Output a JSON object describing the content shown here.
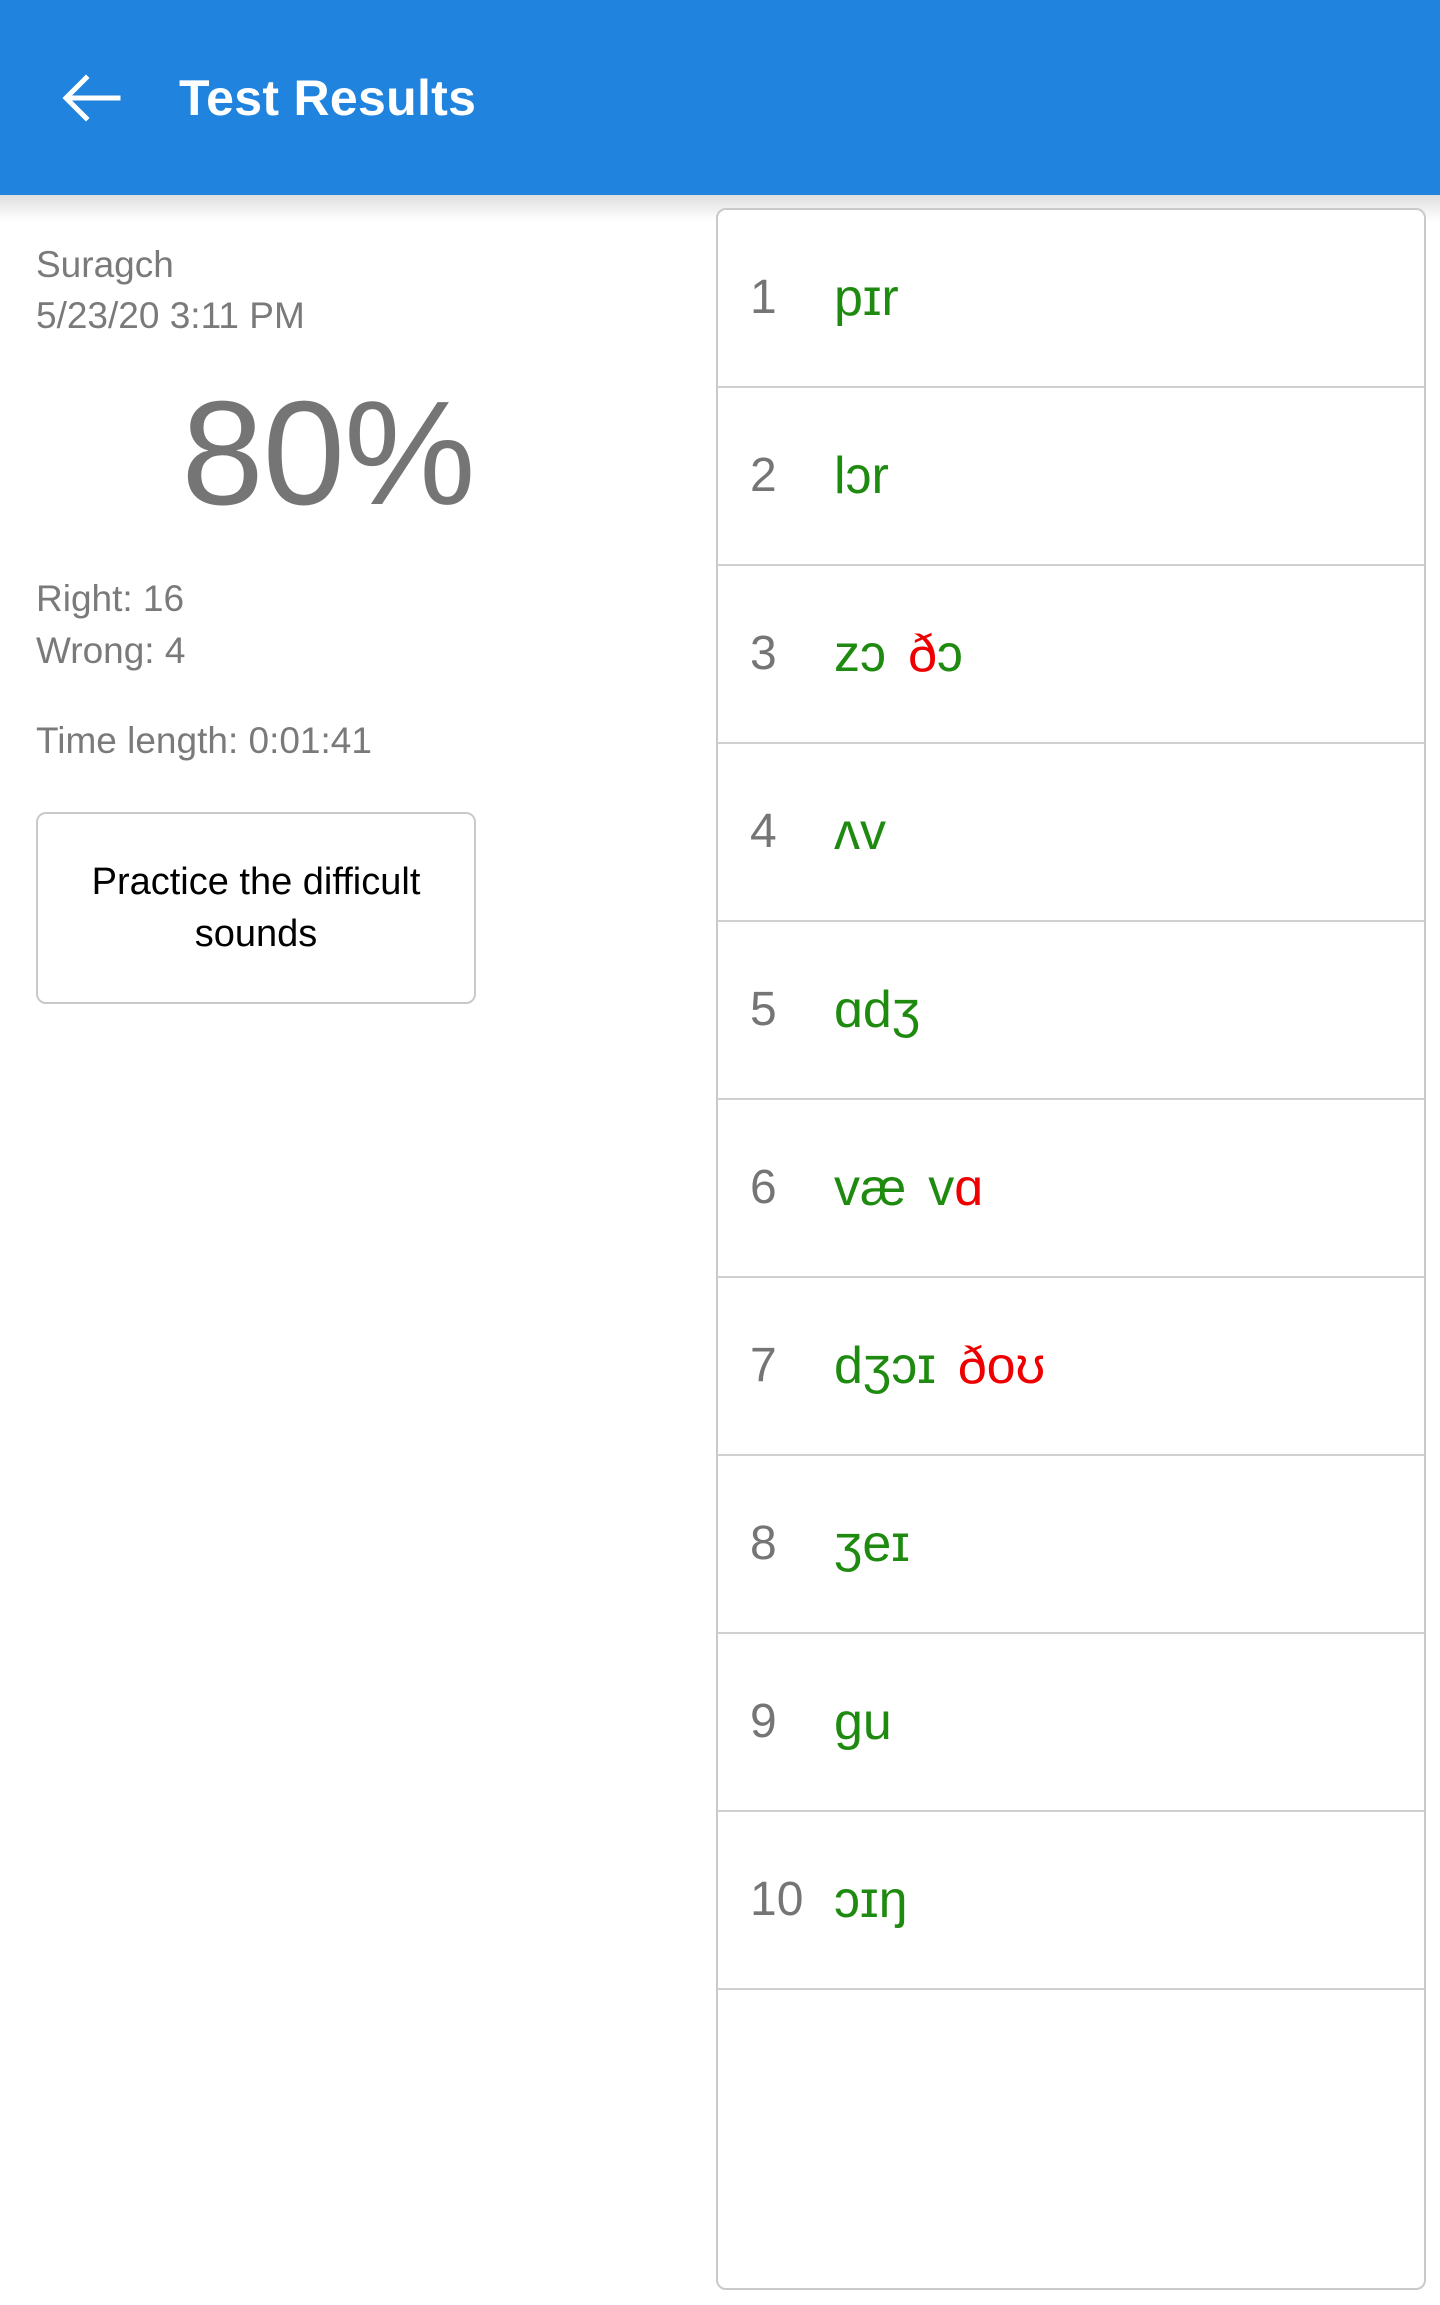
{
  "appbar": {
    "back_icon": "back-arrow-icon",
    "title": "Test Results",
    "background_color": "#2083de",
    "text_color": "#ffffff"
  },
  "summary": {
    "user_name": "Suragch",
    "timestamp": "5/23/20 3:11 PM",
    "percent": "80%",
    "right_label": "Right: 16",
    "wrong_label": "Wrong: 4",
    "time_length_label": "Time length: 0:01:41",
    "practice_button_label": "Practice the difficult sounds"
  },
  "colors": {
    "correct": "#1f8a10",
    "wrong": "#ee0000",
    "muted_text": "#7a7a7a",
    "index_text": "#757575",
    "border": "#c9c9c9"
  },
  "results": {
    "rows": [
      {
        "index": "1",
        "segments": [
          {
            "text": "pɪr",
            "state": "correct"
          }
        ]
      },
      {
        "index": "2",
        "segments": [
          {
            "text": "lɔr",
            "state": "correct"
          }
        ]
      },
      {
        "index": "3",
        "segments": [
          {
            "text": "zɔ",
            "state": "correct"
          },
          {
            "text": "ð",
            "state": "wrong"
          },
          {
            "text": "ɔ",
            "state": "correct"
          }
        ],
        "gap_after": 0
      },
      {
        "index": "4",
        "segments": [
          {
            "text": "ʌv",
            "state": "correct"
          }
        ]
      },
      {
        "index": "5",
        "segments": [
          {
            "text": "ɑdʒ",
            "state": "correct"
          }
        ]
      },
      {
        "index": "6",
        "segments": [
          {
            "text": "væ",
            "state": "correct"
          },
          {
            "text": "v",
            "state": "correct"
          },
          {
            "text": "ɑ",
            "state": "wrong"
          }
        ],
        "gap_after": 0
      },
      {
        "index": "7",
        "segments": [
          {
            "text": "dʒɔɪ",
            "state": "correct"
          },
          {
            "text": "ðoʊ",
            "state": "wrong"
          }
        ],
        "gap_after": 0
      },
      {
        "index": "8",
        "segments": [
          {
            "text": "ʒeɪ",
            "state": "correct"
          }
        ]
      },
      {
        "index": "9",
        "segments": [
          {
            "text": "gu",
            "state": "correct"
          }
        ]
      },
      {
        "index": "10",
        "segments": [
          {
            "text": "ɔɪŋ",
            "state": "correct"
          }
        ]
      }
    ]
  }
}
